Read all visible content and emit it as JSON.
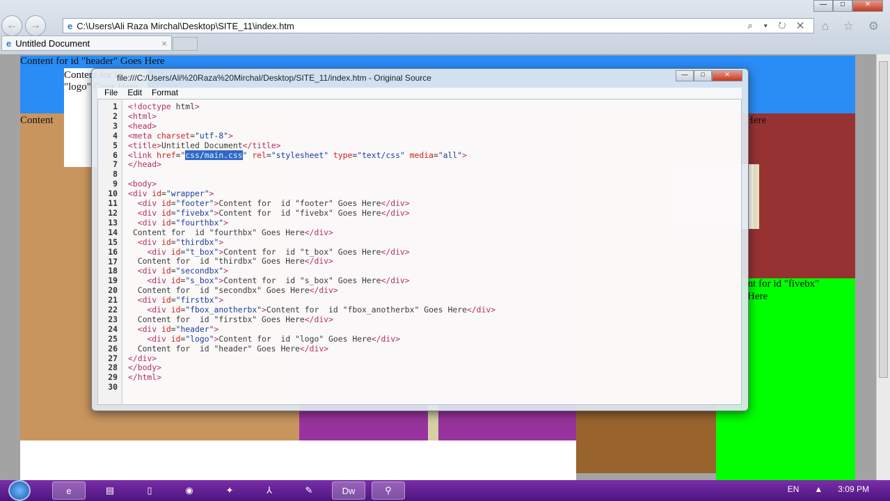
{
  "browser": {
    "address": "C:\\Users\\Ali Raza Mirchal\\Desktop\\SITE_11\\index.htm",
    "tab_title": "Untitled Document",
    "tab_close": "×",
    "back": "←",
    "forward": "→",
    "addr_tools": "⌕ ▾ ↻ ✕",
    "right_icons": "⌂ ☆ ⚙"
  },
  "page": {
    "header_text": "Content for id \"header\" Goes Here",
    "logo_text": "Content for id \"logo\" Goes Here",
    "content_text": "Content",
    "here_text": "Here",
    "fivebx_text": "ent for id \"fivebx\"",
    "fivebx_here": "Here"
  },
  "colors": {
    "header": "#2a8cf5",
    "tan": "#c9955f",
    "purple": "#98339e",
    "brown": "#99632e",
    "green": "#00ff00",
    "darkred": "#973233"
  },
  "source_window": {
    "title": "file:///C:/Users/Ali%20Raza%20Mirchal/Desktop/SITE_11/index.htm - Original Source",
    "menu": [
      "File",
      "Edit",
      "Format"
    ],
    "min": "—",
    "max": "□",
    "close": "✕",
    "lines": [
      "<!doctype html>",
      "<html>",
      "<head>",
      "<meta charset=\"utf-8\">",
      "<title>Untitled Document</title>",
      "<link href=\"css/main.css\" rel=\"stylesheet\" type=\"text/css\" media=\"all\">",
      "</head>",
      "",
      "<body>",
      "<div id=\"wrapper\">",
      "  <div id=\"footer\">Content for  id \"footer\" Goes Here</div>",
      "  <div id=\"fivebx\">Content for  id \"fivebx\" Goes Here</div>",
      "  <div id=\"fourthbx\">",
      " Content for  id \"fourthbx\" Goes Here</div>",
      "  <div id=\"thirdbx\">",
      "    <div id=\"t_box\">Content for  id \"t_box\" Goes Here</div>",
      "  Content for  id \"thirdbx\" Goes Here</div>",
      "  <div id=\"secondbx\">",
      "    <div id=\"s_box\">Content for  id \"s_box\" Goes Here</div>",
      "  Content for  id \"secondbx\" Goes Here</div>",
      "  <div id=\"firstbx\">",
      "    <div id=\"fbox_anotherbx\">Content for  id \"fbox_anotherbx\" Goes Here</div>",
      "  Content for  id \"firstbx\" Goes Here</div>",
      "  <div id=\"header\">",
      "    <div id=\"logo\">Content for  id \"logo\" Goes Here</div>",
      "  Content for  id \"header\" Goes Here</div>",
      "</div>",
      "</body>",
      "</html>",
      ""
    ],
    "selected_text": "css/main.css"
  },
  "taskbar": {
    "apps": [
      "e",
      "▤",
      "▯",
      "◉",
      "✦",
      "⅄",
      "✎",
      "Dw",
      "⚲"
    ],
    "lang": "EN",
    "tray_arrow": "▲",
    "time": "3:09 PM"
  }
}
